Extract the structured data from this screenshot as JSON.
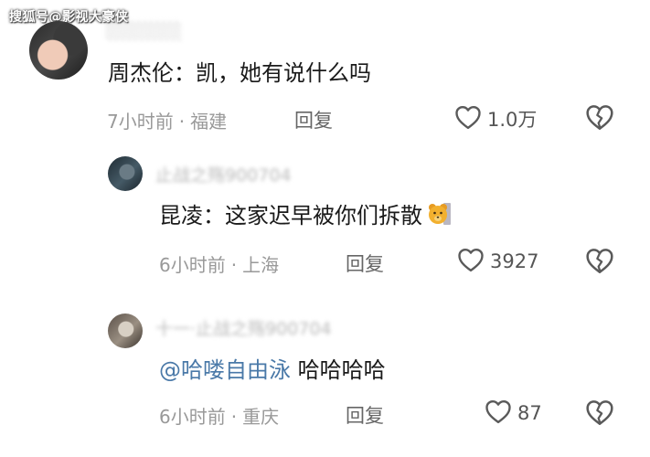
{
  "watermark": "搜狐号@影视大豪侠",
  "icons": {
    "like": "heart-outline-icon",
    "dislike": "broken-heart-icon",
    "emoji": "bear-emoji-icon"
  },
  "colors": {
    "mention": "#4a79a8",
    "meta": "#999999",
    "text": "#1a1a1a"
  },
  "comments": [
    {
      "username": "░░░░░░",
      "text": "周杰伦：凯，她有说什么吗",
      "time": "7小时前",
      "dot": "·",
      "location": "福建",
      "reply_label": "回复",
      "likes": "1.0万"
    },
    {
      "username": "止战之殇900704",
      "text": "昆凌：这家迟早被你们拆散",
      "time": "6小时前",
      "dot": "·",
      "location": "上海",
      "reply_label": "回复",
      "likes": "3927"
    },
    {
      "username": "十一·止战之殇900704",
      "mention": "@哈喽自由泳",
      "text_after": " 哈哈哈哈",
      "time": "6小时前",
      "dot": "·",
      "location": "重庆",
      "reply_label": "回复",
      "likes": "87"
    }
  ]
}
